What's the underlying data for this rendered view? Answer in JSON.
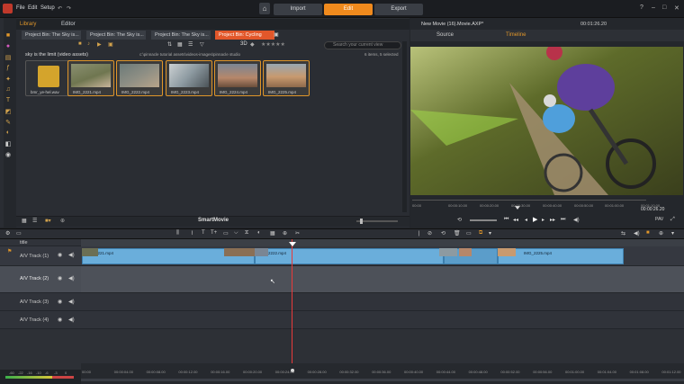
{
  "menu": {
    "file": "File",
    "edit": "Edit",
    "setup": "Setup"
  },
  "mode_tabs": {
    "import": "Import",
    "edit": "Edit",
    "export": "Export",
    "active": "Edit"
  },
  "library_tabs": {
    "library": "Library",
    "editor": "Editor"
  },
  "bin_tabs": [
    "Project Bin: The Sky is...",
    "Project Bin: The Sky is...",
    "Project Bin: The Sky is...",
    "Project Bin: Cycling"
  ],
  "bin_tab_active": "Project Bin: Cycling",
  "view_3d": "3D",
  "search_placeholder": "Search your current view",
  "collection_title": "sky is the limit (video assets)",
  "collection_path": "c:\\pinnacle tutorial assets\\videos-images\\pinnacle studio",
  "collection_count": "6 items, 5 selected",
  "assets": [
    {
      "name": "bmr_ye-hel.wav",
      "type": "audio"
    },
    {
      "name": "IMG_2221.mp4",
      "type": "video"
    },
    {
      "name": "IMG_2222.mp4",
      "type": "video"
    },
    {
      "name": "IMG_2223.mp4",
      "type": "video"
    },
    {
      "name": "IMG_2224.mp4",
      "type": "video"
    },
    {
      "name": "IMG_2225.mp4",
      "type": "video"
    }
  ],
  "library_footer": "SmartMovie",
  "preview": {
    "title": "New Movie (16).Movie.AXP*",
    "timecode": "00:01:26.20",
    "tab_source": "Source",
    "tab_timeline": "Timeline",
    "scrub_ticks": [
      "00:00",
      "00:00:10.00",
      "00:00:20.00",
      "00:00:30.00",
      "00:00:40.00",
      "00:00:50.00",
      "00:01:00.00",
      "00:01:10.00"
    ],
    "right_timecode": "00:00:26.20",
    "fmt_label": "PAV"
  },
  "tracks": [
    {
      "label": "title",
      "name": "",
      "interactable": true
    },
    {
      "label": "A/V Track (1)",
      "name": "av-track-1"
    },
    {
      "label": "A/V Track (2)",
      "name": "av-track-2"
    },
    {
      "label": "A/V Track (3)",
      "name": "av-track-3"
    },
    {
      "label": "A/V Track (4)",
      "name": "av-track-4"
    }
  ],
  "clips": [
    "IMG_2221.mp4",
    "IMG_2222.mp4",
    "IMG_2225.mp4"
  ],
  "ruler_ticks": [
    "00:00",
    "00:00:04.00",
    "00:00:08.00",
    "00:00:12.00",
    "00:00:16.00",
    "00:00:20.00",
    "00:00:24.00",
    "00:00:28.00",
    "00:00:32.00",
    "00:00:36.00",
    "00:00:40.00",
    "00:00:44.00",
    "00:00:48.00",
    "00:00:52.00",
    "00:00:56.00",
    "00:01:00.00",
    "00:01:04.00",
    "00:01:08.00",
    "00:01:12.00"
  ],
  "level_ticks": [
    "-60",
    "-22",
    "-16",
    "-10",
    "-6",
    "-3",
    "0"
  ],
  "colors": {
    "accent": "#f08a1d",
    "active_bin": "#e2572a",
    "clip": "#6aaedb",
    "playhead": "#e83a3a"
  }
}
